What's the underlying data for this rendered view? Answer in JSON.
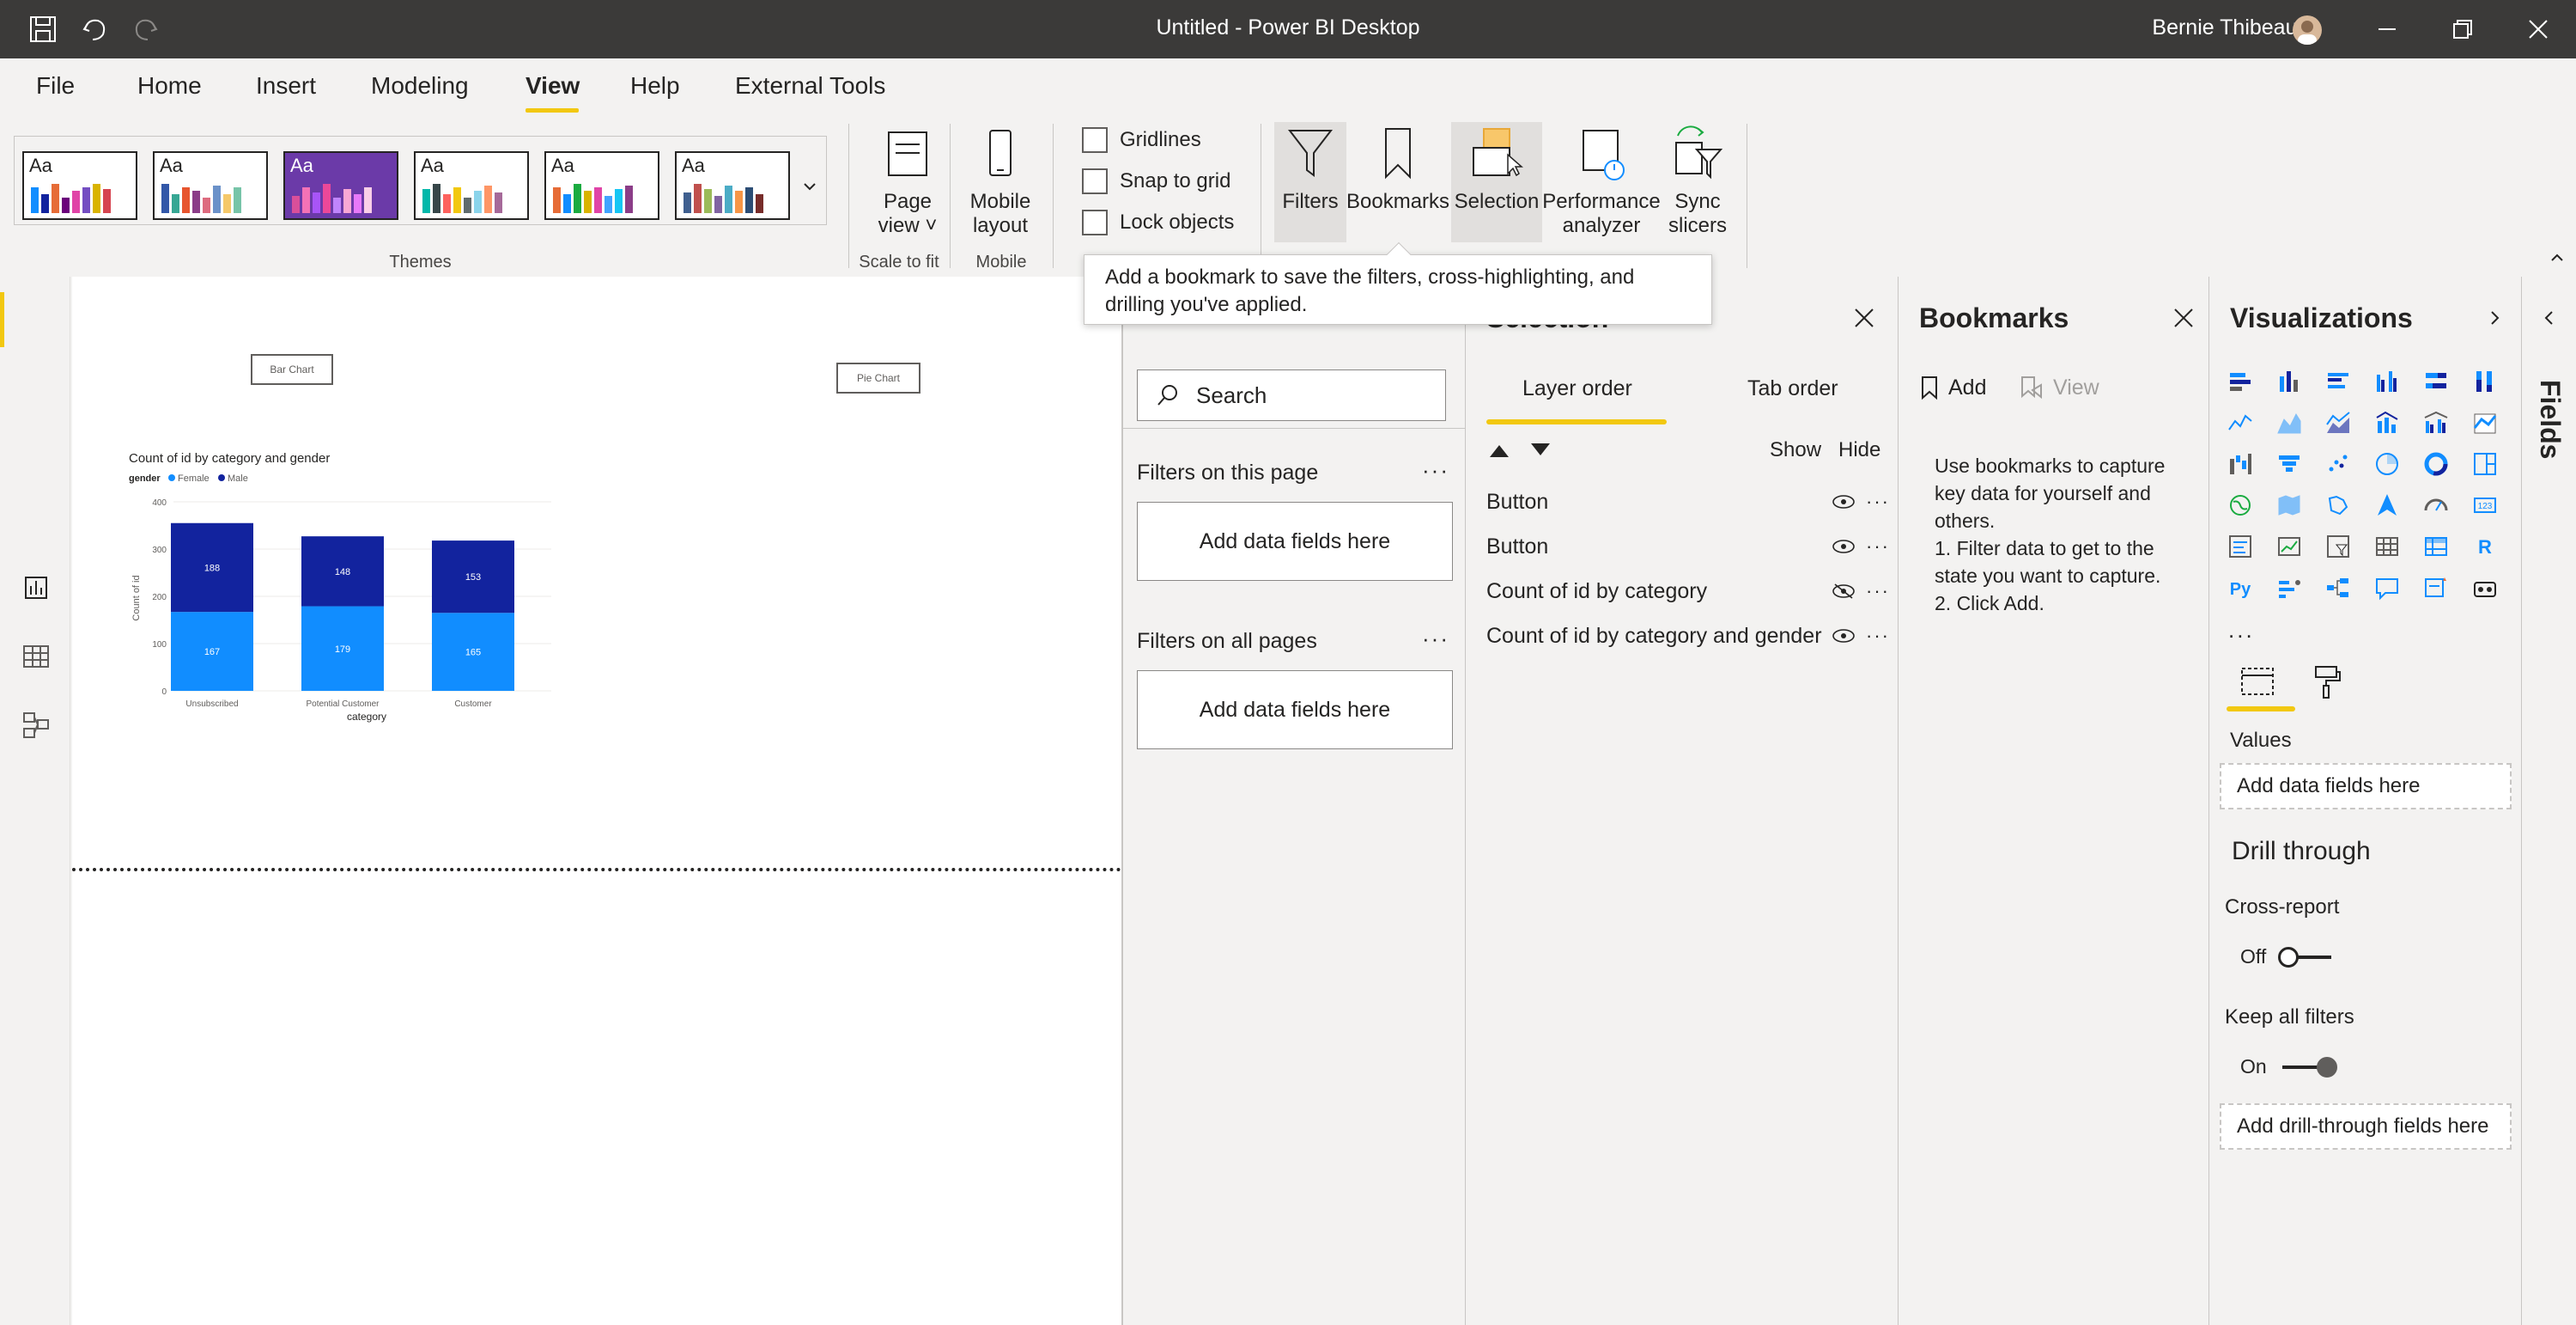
{
  "window": {
    "title": "Untitled - Power BI Desktop",
    "user": "Bernie Thibeault"
  },
  "menu": {
    "items": [
      "File",
      "Home",
      "Insert",
      "Modeling",
      "View",
      "Help",
      "External Tools"
    ],
    "active": "View"
  },
  "ribbon": {
    "theme_label": "Aa",
    "groups": {
      "themes": "Themes",
      "scale": "Scale to fit",
      "mobile": "Mobile"
    },
    "page_view": [
      "Page",
      "view"
    ],
    "mobile_layout": [
      "Mobile",
      "layout"
    ],
    "checkboxes": [
      "Gridlines",
      "Snap to grid",
      "Lock objects"
    ],
    "pane_buttons": {
      "filters": "Filters",
      "bookmarks": "Bookmarks",
      "selection": "Selection",
      "performance": [
        "Performance",
        "analyzer"
      ],
      "sync": [
        "Sync",
        "slicers"
      ]
    }
  },
  "tooltip": {
    "line1": "Add a bookmark to save the filters, cross-highlighting, and",
    "line2": "drilling you've applied."
  },
  "canvas": {
    "button_bar": "Bar Chart",
    "button_pie": "Pie Chart"
  },
  "chart_data": {
    "type": "bar",
    "stacked": true,
    "title": "Count of id by category and gender",
    "legend_title": "gender",
    "legend_position": "top-left",
    "xlabel": "category",
    "ylabel": "Count of id",
    "ylim": [
      0,
      400
    ],
    "yticks": [
      0,
      100,
      200,
      300,
      400
    ],
    "categories": [
      "Unsubscribed",
      "Potential Customer",
      "Customer"
    ],
    "series": [
      {
        "name": "Female",
        "values": [
          167,
          179,
          165
        ],
        "color": "#118dff"
      },
      {
        "name": "Male",
        "values": [
          188,
          148,
          153
        ],
        "color": "#12239e"
      }
    ]
  },
  "filters_pane": {
    "search_placeholder": "Search",
    "on_this_page": "Filters on this page",
    "on_all_pages": "Filters on all pages",
    "add_fields": "Add data fields here"
  },
  "selection_pane": {
    "title": "Selection",
    "tabs": [
      "Layer order",
      "Tab order"
    ],
    "show": "Show",
    "hide": "Hide",
    "items": [
      "Button",
      "Button",
      "Count of id by category",
      "Count of id by category and gender"
    ]
  },
  "bookmarks_pane": {
    "title": "Bookmarks",
    "add": "Add",
    "view": "View",
    "help": [
      "Use bookmarks to capture key data for yourself and others.",
      "1. Filter data to get to the state you want to capture.",
      "2. Click Add."
    ]
  },
  "viz_pane": {
    "title": "Visualizations",
    "values_label": "Values",
    "add_fields": "Add data fields here",
    "drill_through": "Drill through",
    "cross_report": "Cross-report",
    "cross_report_state": "Off",
    "keep_filters": "Keep all filters",
    "keep_filters_state": "On",
    "add_drill": "Add drill-through fields here",
    "more": "..."
  },
  "fields_pane": {
    "title": "Fields"
  },
  "colors": {
    "accent": "#f2c811",
    "titlebar": "#3b3a39"
  }
}
